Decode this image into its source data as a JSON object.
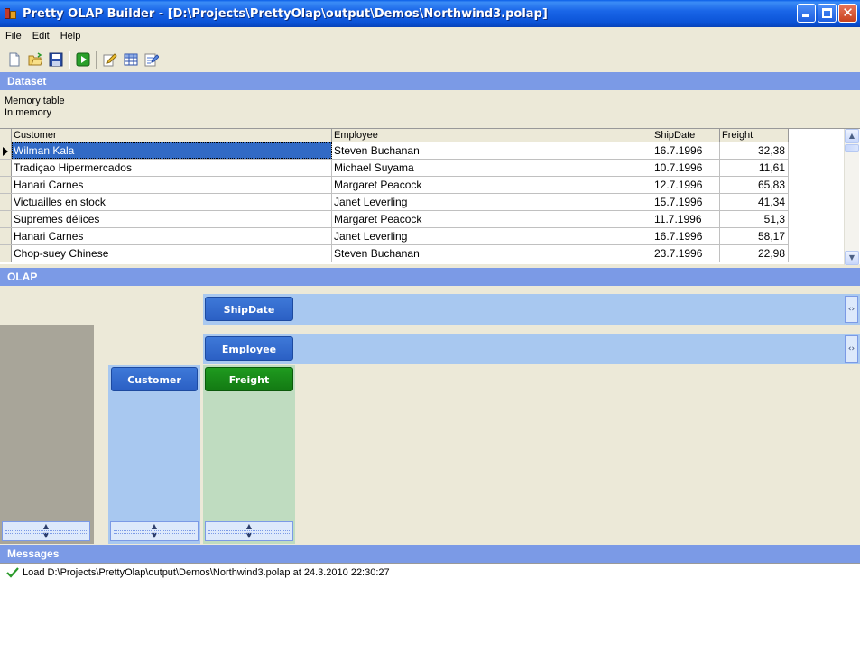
{
  "window": {
    "title": "Pretty OLAP Builder - [D:\\Projects\\PrettyOlap\\output\\Demos\\Northwind3.polap]"
  },
  "menu": [
    "File",
    "Edit",
    "Help"
  ],
  "toolbar": {
    "icons": [
      "new-file-icon",
      "open-folder-icon",
      "save-icon",
      "run-icon",
      "edit-pencil-icon",
      "grid-table-icon",
      "edit-document-icon"
    ]
  },
  "dataset": {
    "header": "Dataset",
    "info_line1": "Memory table",
    "info_line2": "In memory",
    "columns": [
      "Customer",
      "Employee",
      "ShipDate",
      "Freight"
    ],
    "rows": [
      [
        "Wilman Kala",
        "Steven Buchanan",
        "16.7.1996",
        "32,38"
      ],
      [
        "Tradiçao Hipermercados",
        "Michael Suyama",
        "10.7.1996",
        "11,61"
      ],
      [
        "Hanari Carnes",
        "Margaret Peacock",
        "12.7.1996",
        "65,83"
      ],
      [
        "Victuailles en stock",
        "Janet Leverling",
        "15.7.1996",
        "41,34"
      ],
      [
        "Supremes délices",
        "Margaret Peacock",
        "11.7.1996",
        "51,3"
      ],
      [
        "Hanari Carnes",
        "Janet Leverling",
        "16.7.1996",
        "58,17"
      ],
      [
        "Chop-suey Chinese",
        "Steven Buchanan",
        "23.7.1996",
        "22,98"
      ]
    ]
  },
  "olap": {
    "header": "OLAP",
    "column_dims": [
      "ShipDate",
      "Employee"
    ],
    "row_dim": "Customer",
    "value_field": "Freight"
  },
  "messages": {
    "header": "Messages",
    "items": [
      "Load D:\\Projects\\PrettyOlap\\output\\Demos\\Northwind3.polap at 24.3.2010 22:30:27"
    ]
  },
  "colors": {
    "header_blue": "#7b9ae6",
    "dim_blue": "#2b60c4",
    "dim_green": "#137a13",
    "area_blue": "#a8c8f0",
    "area_green": "#bfdcc0"
  }
}
